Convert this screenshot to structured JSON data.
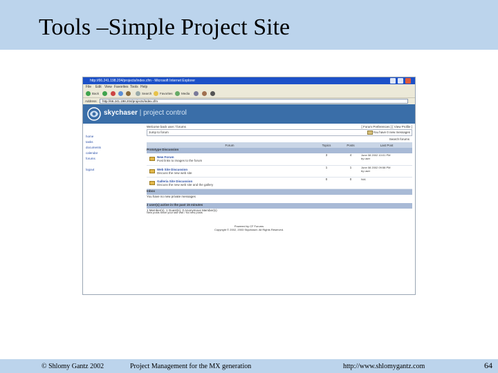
{
  "slide": {
    "title": "Tools –Simple  Project Site",
    "footer_left": "© Shlomy Gantz 2002",
    "footer_center": "Project Management for the MX generation",
    "footer_url": "http://www.shlomygantz.com",
    "page_number": "64"
  },
  "browser": {
    "window_title": "http://66.241.198.204/projects/index.cfm - Microsoft Internet Explorer",
    "menu": [
      "File",
      "Edit",
      "View",
      "Favorites",
      "Tools",
      "Help"
    ],
    "toolbar": [
      "Back",
      "Search",
      "Favorites",
      "Media"
    ],
    "address_label": "Address",
    "address_value": "http://66.241.198.204/projects/index.cfm"
  },
  "site": {
    "logo_brand": "skychaser",
    "logo_sub": "| project control",
    "nav": [
      "home",
      "tasks",
      "documents",
      "calendar",
      "forums",
      "logout"
    ],
    "welcome": "Welcome back user / forums",
    "toplinks": "[ Forum Preferences ] [ View Profile ]",
    "jump_text": "Jump to forum",
    "jump_right": "You have 0 new messages",
    "search_link": "Search forums",
    "table_headers": [
      "Forum",
      "Topics",
      "Posts",
      "Last Post"
    ],
    "category": "Prototype Discussion",
    "forums": [
      {
        "name": "New Forum",
        "desc": "Post links to images to the forum",
        "topics": "3",
        "posts": "4",
        "last": [
          "June 08 2002 10:01 PM",
          "by user"
        ]
      },
      {
        "name": "Web Site Discussion",
        "desc": "Discuss the new web site",
        "topics": "1",
        "posts": "1",
        "last": [
          "June 08 2002 09:58 PM",
          "by user"
        ]
      },
      {
        "name": "Galleria Site Discussion",
        "desc": "Discuss the new web site and the gallery",
        "topics": "0",
        "posts": "0",
        "last": [
          "N/A"
        ]
      }
    ],
    "inbox_label": "Inbox",
    "inbox_text": "You have no new private messages",
    "active_label": "2 user(s) active in the past 15 minutes",
    "active_text": "1 Member(s), 1 Guest(s), 0 Anonymous Member(s)",
    "legend": "New posts since your last visit / No new posts",
    "credit_1": "Powered by CF Forums",
    "credit_2": "Copyright © 2002, 2003 Skychaser. All Rights Reserved."
  },
  "colors": {
    "slide_band": "#bcd4ec",
    "titlebar_blue": "#1c50c8",
    "banner_blue": "#3a6ea8"
  }
}
